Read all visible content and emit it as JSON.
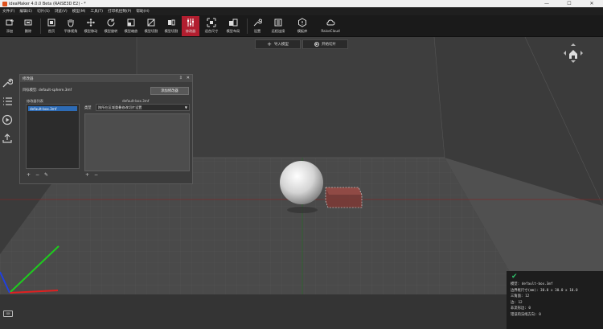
{
  "window": {
    "title": "ideaMaker 4.0.0 Beta (RAISE3D E2) - *",
    "controls": [
      "—",
      "☐",
      "✕"
    ]
  },
  "menu": [
    "文件(F)",
    "编辑(E)",
    "切片(S)",
    "浏览(V)",
    "模型(M)",
    "工具(T)",
    "打印机控制(P)",
    "帮助(H)"
  ],
  "toolbar": {
    "tools": [
      {
        "label": "添加",
        "icon": "add-model-icon"
      },
      {
        "label": "删除",
        "icon": "delete-icon"
      },
      {
        "label": "首页",
        "icon": "home-icon"
      },
      {
        "label": "平移视角",
        "icon": "pan-hand-icon"
      },
      {
        "label": "模型移动",
        "icon": "move-icon"
      },
      {
        "label": "模型旋转",
        "icon": "rotate-icon"
      },
      {
        "label": "模型缩放",
        "icon": "scale-icon"
      },
      {
        "label": "模型切割",
        "icon": "cut-icon"
      },
      {
        "label": "模型切割",
        "icon": "split-icon"
      },
      {
        "label": "合成结构",
        "icon": "merge-icon"
      },
      {
        "label": "修改器",
        "icon": "modifier-icon"
      },
      {
        "label": "适合尺寸",
        "icon": "fit-size-icon"
      },
      {
        "label": "模型布局",
        "icon": "layout-icon"
      },
      {
        "label": "设置",
        "icon": "settings-icon"
      },
      {
        "label": "远程连接",
        "icon": "remote-icon"
      },
      {
        "label": "模板库",
        "icon": "template-icon"
      },
      {
        "label": "RaiseCloud",
        "icon": "cloud-icon"
      }
    ]
  },
  "viewport": {
    "import_model_button": "导入模型",
    "start_slice_button": "开始切片"
  },
  "modifier_panel": {
    "title": "修改器",
    "target_label": "目标模型: default-sphere.3mf",
    "add_button": "添加修改器",
    "list_header": "修改器列表",
    "right_header": "default-box.3mf",
    "list_items": [
      "default-box.3mf"
    ],
    "type_label": "类型",
    "type_value": "按所在区域重叠修改切片设置"
  },
  "model_info": {
    "lines": [
      "模型: default-box.3mf",
      "边界框尺寸(mm): 30.0 x 30.0 x 10.0",
      "三角面: 12",
      "边: 12",
      "非流形边: 0",
      "错误的法线方向: 0"
    ]
  },
  "colors": {
    "accent": "#b21e2f",
    "ok": "#2fc06b",
    "selection": "#2d6bb5"
  }
}
